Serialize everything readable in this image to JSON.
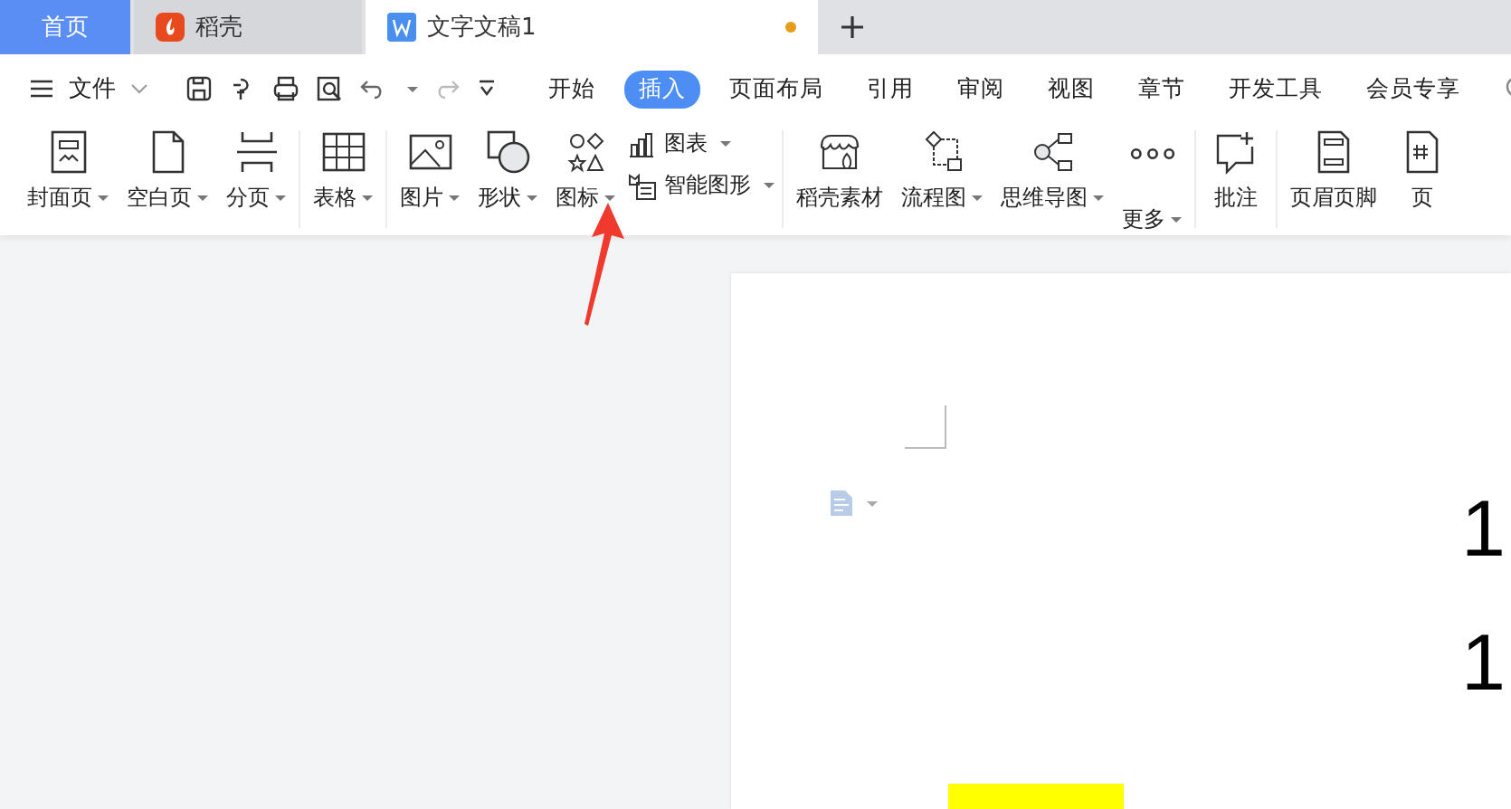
{
  "tabs": [
    {
      "label": "首页",
      "selected": false,
      "kind": "home"
    },
    {
      "label": "稻壳",
      "selected": false,
      "kind": "app"
    },
    {
      "label": "文字文稿1",
      "selected": true,
      "kind": "doc",
      "modified": true
    }
  ],
  "file_menu": {
    "label": "文件"
  },
  "ribbon_tabs": [
    {
      "label": "开始",
      "selected": false
    },
    {
      "label": "插入",
      "selected": true
    },
    {
      "label": "页面布局",
      "selected": false
    },
    {
      "label": "引用",
      "selected": false
    },
    {
      "label": "审阅",
      "selected": false
    },
    {
      "label": "视图",
      "selected": false
    },
    {
      "label": "章节",
      "selected": false
    },
    {
      "label": "开发工具",
      "selected": false
    },
    {
      "label": "会员专享",
      "selected": false
    }
  ],
  "ribbon_groups": [
    {
      "items": [
        {
          "kind": "large",
          "label": "封面页",
          "dropdown": true
        },
        {
          "kind": "large",
          "label": "空白页",
          "dropdown": true
        },
        {
          "kind": "large",
          "label": "分页",
          "dropdown": true
        }
      ]
    },
    {
      "items": [
        {
          "kind": "large",
          "label": "表格",
          "dropdown": true
        }
      ]
    },
    {
      "items": [
        {
          "kind": "large",
          "label": "图片",
          "dropdown": true
        },
        {
          "kind": "large",
          "label": "形状",
          "dropdown": true
        },
        {
          "kind": "large",
          "label": "图标",
          "dropdown": true
        },
        {
          "kind": "stack",
          "children": [
            {
              "label": "图表",
              "dropdown": true
            },
            {
              "label": "智能图形",
              "dropdown": true
            }
          ]
        }
      ]
    },
    {
      "items": [
        {
          "kind": "large",
          "label": "稻壳素材",
          "dropdown": false
        },
        {
          "kind": "large",
          "label": "流程图",
          "dropdown": true
        },
        {
          "kind": "large",
          "label": "思维导图",
          "dropdown": true
        },
        {
          "kind": "large",
          "label": "更多",
          "dropdown": true
        }
      ]
    },
    {
      "items": [
        {
          "kind": "large",
          "label": "批注",
          "dropdown": false
        }
      ]
    },
    {
      "items": [
        {
          "kind": "large",
          "label": "页眉页脚",
          "dropdown": false
        },
        {
          "kind": "large",
          "label": "页",
          "dropdown": false
        }
      ]
    }
  ],
  "document": {
    "lines": [
      "1",
      "1"
    ]
  }
}
